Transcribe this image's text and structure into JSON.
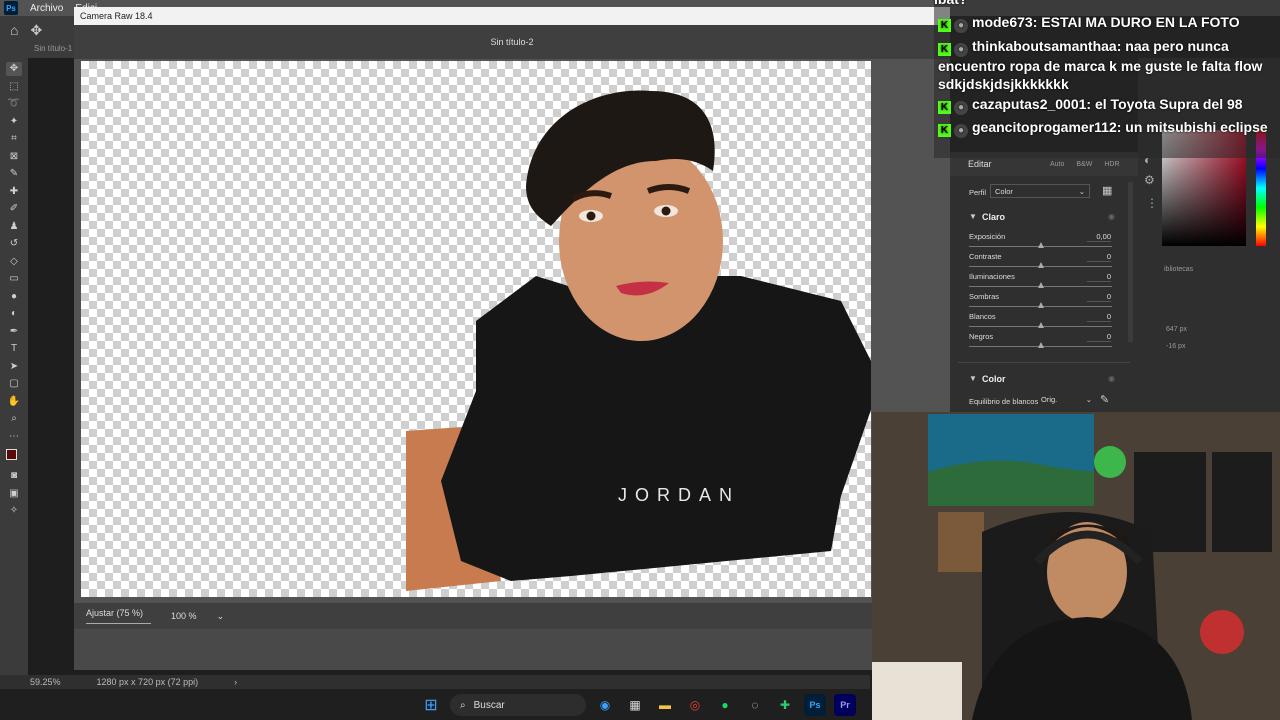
{
  "photoshop": {
    "menu": [
      "Archivo",
      "Edici"
    ],
    "doc_tab": "Sin título-1",
    "zoom_status": "59.25%",
    "doc_info": "1280 px x 720 px (72 ppi)"
  },
  "camera_raw": {
    "window_title": "Camera Raw 18.4",
    "doc_title": "Sin título-2",
    "zoom_fit": "Ajustar (75 %)",
    "zoom_100": "100 %",
    "shirt_text": "JORDAN"
  },
  "edit_panel": {
    "title": "Editar",
    "tabs": [
      "Auto",
      "B&W",
      "HDR"
    ],
    "profile_label": "Perfil",
    "profile_value": "Color",
    "section_light": "Claro",
    "sliders": [
      {
        "label": "Exposición",
        "value": "0,00"
      },
      {
        "label": "Contraste",
        "value": "0"
      },
      {
        "label": "Iluminaciones",
        "value": "0"
      },
      {
        "label": "Sombras",
        "value": "0"
      },
      {
        "label": "Blancos",
        "value": "0"
      },
      {
        "label": "Negros",
        "value": "0"
      }
    ],
    "section_color": "Color",
    "wb_label": "Equilibrio de blancos",
    "wb_value": "Orig."
  },
  "right_panel": {
    "libraries": "ibliotecas",
    "w_value": "647 px",
    "h_value": "-16 px"
  },
  "chat": {
    "top_fragment": "ibat?",
    "messages": [
      {
        "user": "mode673",
        "text": "ESTAI MA DURO EN LA FOTO"
      },
      {
        "user": "thinkaboutsamanthaa",
        "text": "naa pero nunca encuentro ropa de marca k me guste le falta flow sdkjdskjdsjkkkkkkk"
      },
      {
        "user": "cazaputas2_0001",
        "text": "el Toyota Supra del 98"
      },
      {
        "user": "geancitoprogamer112",
        "text": "un mitsubishi eclipse"
      }
    ]
  },
  "taskbar": {
    "search": "Buscar"
  },
  "colors": {
    "kick_green": "#53fc18",
    "ps_blue": "#31a8ff"
  }
}
